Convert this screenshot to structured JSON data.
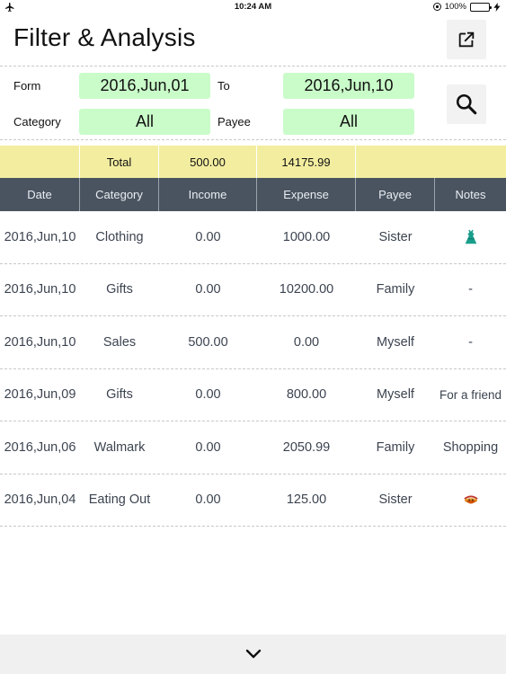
{
  "status_bar": {
    "time": "10:24 AM",
    "battery": "100%"
  },
  "header": {
    "title": "Filter & Analysis"
  },
  "filters": {
    "from_label": "Form",
    "from_value": "2016,Jun,01",
    "to_label": "To",
    "to_value": "2016,Jun,10",
    "category_label": "Category",
    "category_value": "All",
    "payee_label": "Payee",
    "payee_value": "All"
  },
  "totals": {
    "label": "Total",
    "income": "500.00",
    "expense": "14175.99"
  },
  "table": {
    "columns": [
      "Date",
      "Category",
      "Income",
      "Expense",
      "Payee",
      "Notes"
    ],
    "rows": [
      {
        "date": "2016,Jun,10",
        "category": "Clothing",
        "income": "0.00",
        "expense": "1000.00",
        "payee": "Sister",
        "notes": "",
        "note_icon": "dress-icon"
      },
      {
        "date": "2016,Jun,10",
        "category": "Gifts",
        "income": "0.00",
        "expense": "10200.00",
        "payee": "Family",
        "notes": "-"
      },
      {
        "date": "2016,Jun,10",
        "category": "Sales",
        "income": "500.00",
        "expense": "0.00",
        "payee": "Myself",
        "notes": "-"
      },
      {
        "date": "2016,Jun,09",
        "category": "Gifts",
        "income": "0.00",
        "expense": "800.00",
        "payee": "Myself",
        "notes": "For a friend"
      },
      {
        "date": "2016,Jun,06",
        "category": "Walmark",
        "income": "0.00",
        "expense": "2050.99",
        "payee": "Family",
        "notes": "Shopping"
      },
      {
        "date": "2016,Jun,04",
        "category": "Eating Out",
        "income": "0.00",
        "expense": "125.00",
        "payee": "Sister",
        "notes": "",
        "note_icon": "food-bowl-icon"
      }
    ]
  },
  "colors": {
    "filter_field_bg": "#c9fcc9",
    "total_bar_bg": "#f3eda0",
    "table_header_bg": "#4a5460",
    "battery_green": "#35c759"
  },
  "icons": [
    "airplane-icon",
    "rotation-lock-icon",
    "battery-icon",
    "export-icon",
    "search-icon",
    "chevron-down-icon",
    "dress-icon",
    "food-bowl-icon"
  ]
}
